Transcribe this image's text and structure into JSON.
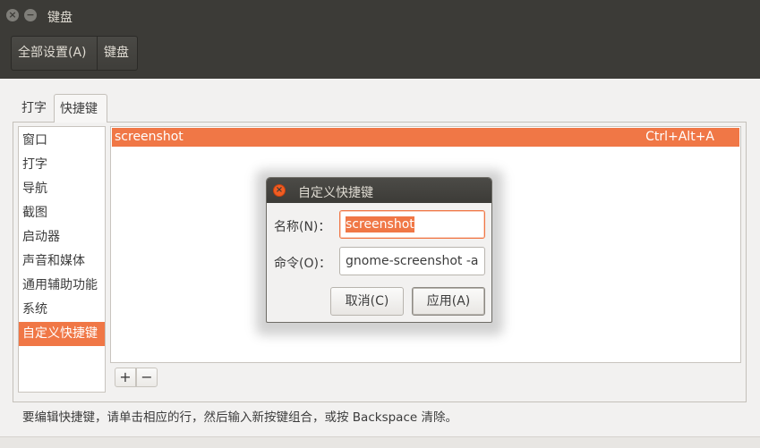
{
  "window": {
    "title": "键盘",
    "close_glyph": "×",
    "minimize_glyph": "−"
  },
  "breadcrumb": {
    "all_settings": "全部设置(A)",
    "current": "键盘"
  },
  "tabs": [
    {
      "label": "打字",
      "active": false
    },
    {
      "label": "快捷键",
      "active": true
    }
  ],
  "categories": [
    {
      "label": "窗口"
    },
    {
      "label": "打字"
    },
    {
      "label": "导航"
    },
    {
      "label": "截图"
    },
    {
      "label": "启动器"
    },
    {
      "label": "声音和媒体"
    },
    {
      "label": "通用辅助功能"
    },
    {
      "label": "系统"
    },
    {
      "label": "自定义快捷键",
      "selected": true
    }
  ],
  "shortcuts": [
    {
      "name": "screenshot",
      "accel": "Ctrl+Alt+A",
      "selected": true
    }
  ],
  "list_buttons": {
    "add": "+",
    "remove": "−"
  },
  "hint": "要编辑快捷键，请单击相应的行，然后输入新按键组合，或按 Backspace 清除。",
  "dialog": {
    "title": "自定义快捷键",
    "close_glyph": "×",
    "name_label": "名称(N)：",
    "name_value": "screenshot",
    "command_label": "命令(O)：",
    "command_value": "gnome-screenshot -a",
    "cancel": "取消(C)",
    "apply": "应用(A)"
  },
  "colors": {
    "accent": "#f07746",
    "titlebar": "#3c3b37",
    "window_bg": "#f2f1f0"
  }
}
